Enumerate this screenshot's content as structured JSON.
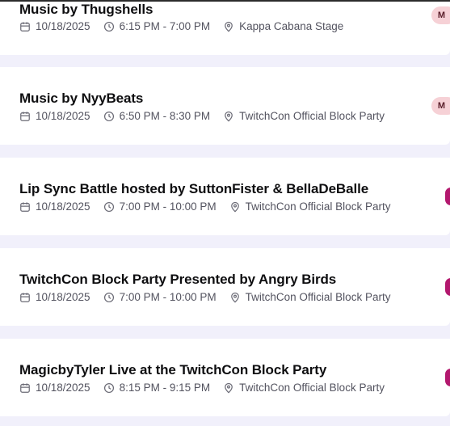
{
  "events": [
    {
      "title": "Music by Thugshells",
      "date": "10/18/2025",
      "time": "6:15 PM - 7:00 PM",
      "location": "Kappa Cabana Stage",
      "badge": "M"
    },
    {
      "title": "Music by NyyBeats",
      "date": "10/18/2025",
      "time": "6:50 PM - 8:30 PM",
      "location": "TwitchCon Official Block Party",
      "badge": "M"
    },
    {
      "title": "Lip Sync Battle hosted by SuttonFister & BellaDeBalle",
      "date": "10/18/2025",
      "time": "7:00 PM - 10:00 PM",
      "location": "TwitchCon Official Block Party",
      "badge": ""
    },
    {
      "title": "TwitchCon Block Party Presented by Angry Birds",
      "date": "10/18/2025",
      "time": "7:00 PM - 10:00 PM",
      "location": "TwitchCon Official Block Party",
      "badge": ""
    },
    {
      "title": "MagicbyTyler Live at the TwitchCon Block Party",
      "date": "10/18/2025",
      "time": "8:15 PM - 9:15 PM",
      "location": "TwitchCon Official Block Party",
      "badge": ""
    }
  ],
  "icons": {
    "date": "calendar-icon",
    "time": "clock-icon",
    "location": "map-pin-icon"
  },
  "colors": {
    "background": "#f1f0fb",
    "card": "#ffffff",
    "title": "#0e0e10",
    "meta": "#53535f",
    "badge_pink": "#f6d1d6",
    "badge_magenta": "#b3186e"
  }
}
